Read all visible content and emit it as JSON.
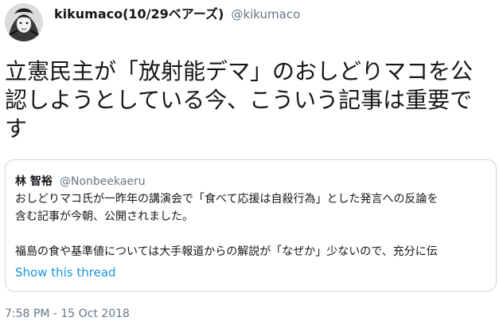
{
  "author": {
    "display_name": "kikumaco(10/29ベアーズ)",
    "handle": "@kikumaco"
  },
  "tweet": {
    "text": "立憲民主が「放射能デマ」のおしどりマコを公認しようとしている今、こういう記事は重要です",
    "timestamp": "7:58 PM - 15 Oct 2018"
  },
  "quoted": {
    "name": "林 智裕",
    "handle": "@Nonbeekaeru",
    "line1": "おしどりマコ氏が一昨年の講演会で「食べて応援は自殺行為」とした発言への反論を",
    "line2": "含む記事が今朝、公開されました。",
    "line3": "福島の食や基準値については大手報道からの解説が「なぜか」少ないので、充分に伝",
    "show_thread": "Show this thread"
  }
}
